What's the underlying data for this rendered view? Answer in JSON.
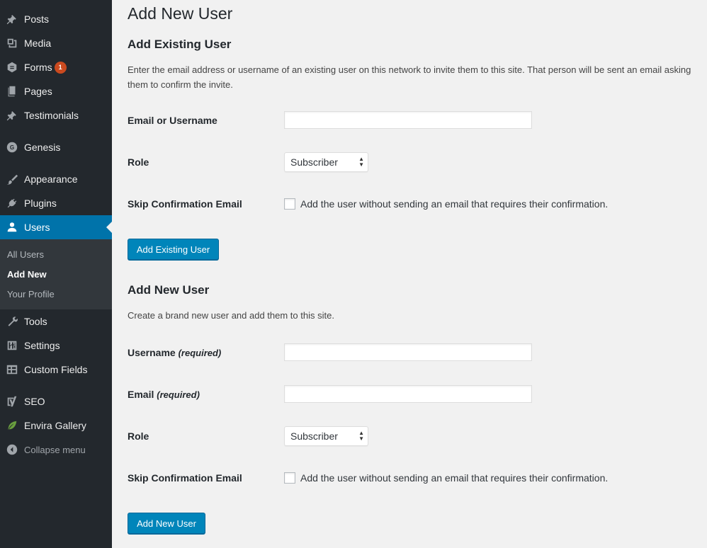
{
  "sidebar": {
    "items": [
      {
        "label": "Posts",
        "icon": "pin-icon"
      },
      {
        "label": "Media",
        "icon": "media-icon"
      },
      {
        "label": "Forms",
        "icon": "forms-icon",
        "badge": "1"
      },
      {
        "label": "Pages",
        "icon": "pages-icon"
      },
      {
        "label": "Testimonials",
        "icon": "pin-icon"
      },
      {
        "label": "Genesis",
        "icon": "genesis-icon"
      },
      {
        "label": "Appearance",
        "icon": "brush-icon"
      },
      {
        "label": "Plugins",
        "icon": "plug-icon"
      },
      {
        "label": "Users",
        "icon": "user-icon",
        "current": true
      },
      {
        "label": "Tools",
        "icon": "wrench-icon"
      },
      {
        "label": "Settings",
        "icon": "settings-icon"
      },
      {
        "label": "Custom Fields",
        "icon": "table-icon"
      },
      {
        "label": "SEO",
        "icon": "yoast-icon"
      },
      {
        "label": "Envira Gallery",
        "icon": "leaf-icon"
      }
    ],
    "submenu": [
      "All Users",
      "Add New",
      "Your Profile"
    ],
    "collapse_label": "Collapse menu"
  },
  "page": {
    "title": "Add New User",
    "existing": {
      "heading": "Add Existing User",
      "description": "Enter the email address or username of an existing user on this network to invite them to this site. That person will be sent an email asking them to confirm the invite.",
      "email_label": "Email or Username",
      "email_value": "",
      "role_label": "Role",
      "role_value": "Subscriber",
      "skip_label": "Skip Confirmation Email",
      "skip_text": "Add the user without sending an email that requires their confirmation.",
      "button": "Add Existing User"
    },
    "new": {
      "heading": "Add New User",
      "description": "Create a brand new user and add them to this site.",
      "username_label": "Username",
      "email_label": "Email",
      "required": "(required)",
      "role_label": "Role",
      "role_value": "Subscriber",
      "skip_label": "Skip Confirmation Email",
      "skip_text": "Add the user without sending an email that requires their confirmation.",
      "button": "Add New User"
    }
  },
  "colors": {
    "sidebar_bg": "#23282d",
    "submenu_bg": "#32373c",
    "accent": "#0073aa",
    "button": "#0085ba",
    "badge": "#ca4a1f"
  }
}
